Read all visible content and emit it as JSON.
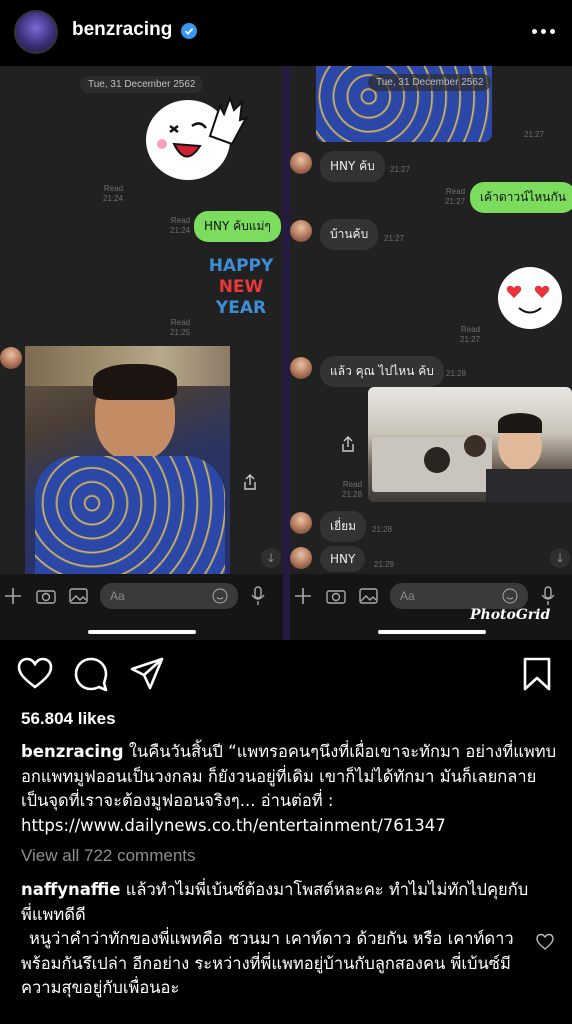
{
  "header": {
    "username": "benzracing"
  },
  "collage": {
    "watermark": "PhotoGrid",
    "left": {
      "date": "Tue, 31 December 2562",
      "read1": "Read",
      "time1": "21:24",
      "msg1": "HNY ค้บแม่ๆ",
      "read2": "Read",
      "time2": "21:24",
      "sticker_text": [
        "HAPPY",
        "NEW",
        "YEAR"
      ],
      "read3": "Read",
      "time3": "21:25",
      "input_placeholder": "Aa"
    },
    "right": {
      "date": "Tue, 31 December 2562",
      "time0": "21:27",
      "msg1": "HNY ค้บ",
      "time1": "21:27",
      "read2": "Read",
      "time2": "21:27",
      "msg2": "เค้าดาวน์ไหนกัน",
      "msg3": "บ้านค้บ",
      "time3": "21:27",
      "read4": "Read",
      "time4": "21:27",
      "msg5": "แล้ว คุณ ไปไหน ค้บ",
      "time5": "21:28",
      "read6": "Read",
      "time6": "21:28",
      "msg7": "เยี่ยม",
      "time7": "21:28",
      "msg8": "HNY",
      "time8": "21:29",
      "input_placeholder": "Aa"
    }
  },
  "likes": "56.804 likes",
  "caption": {
    "username": "benzracing",
    "text": "ในคืนวันสิ้นปี “แพทรอคนๆนึงที่เผื่อเขาจะทักมา อย่างที่แพทบอกแพทมูฟออนเป็นวงกลม ก็ยังวนอยู่ที่เดิม เขาก็ไม่ได้ทักมา มันก็เลยกลายเป็นจุดที่เราจะต้องมูฟออนจริงๆ... อ่านต่อที่ : https://www.dailynews.co.th/entertainment/761347"
  },
  "view_all_comments": "View all 722 comments",
  "comment": {
    "username": "naffynaffie",
    "text": "แล้วทำไมพี่เบ้นซ์ต้องมาโพสต์หละคะ ทำไมไม่ทักไปคุยกับพี่แพทดีดี",
    "text2": "หนูว่าคำว่าทักของพี่แพทคือ ชวนมา เคาท์ดาว ด้วยกัน หรือ เคาท์ดาวพร้อมกันรึเปล่า อีกอย่าง ระหว่างที่พี่แพทอยู่บ้านกับลูกสองคน พี่เบ้นซ์มีความสุขอยู่กับเพื่อนอะ"
  },
  "colors": {
    "background": "#000000",
    "line_green": "#7bdc5e",
    "verified": "#3897f0",
    "muted": "#8e8e8e"
  }
}
